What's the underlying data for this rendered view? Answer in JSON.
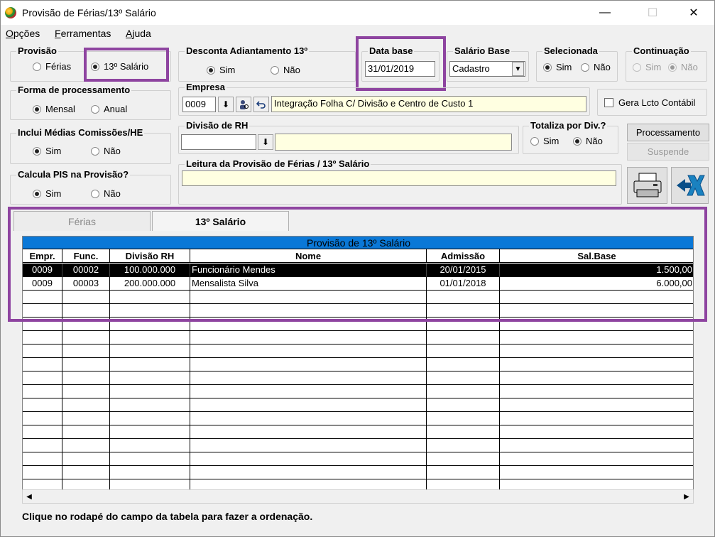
{
  "window": {
    "title": "Provisão de Férias/13º Salário",
    "minimize": "—",
    "maximize": "☐",
    "close": "✕"
  },
  "menu": [
    {
      "label": "Opções",
      "underline": "O"
    },
    {
      "label": "Ferramentas",
      "underline": "F"
    },
    {
      "label": "Ajuda",
      "underline": "A"
    }
  ],
  "provisao": {
    "legend": "Provisão",
    "ferias": "Férias",
    "decimo": "13º Salário",
    "selected": "decimo"
  },
  "desconta": {
    "legend": "Desconta Adiantamento 13º",
    "sim": "Sim",
    "nao": "Não",
    "selected": "sim"
  },
  "data_base": {
    "legend": "Data base",
    "value": "31/01/2019"
  },
  "salario_base": {
    "legend": "Salário Base",
    "value": "Cadastro"
  },
  "selecionada": {
    "legend": "Selecionada",
    "sim": "Sim",
    "nao": "Não",
    "selected": "sim"
  },
  "continuacao": {
    "legend": "Continuação",
    "sim": "Sim",
    "nao": "Não",
    "selected": "nao"
  },
  "forma_processamento": {
    "legend": "Forma de processamento",
    "mensal": "Mensal",
    "anual": "Anual",
    "selected": "mensal"
  },
  "empresa": {
    "legend": "Empresa",
    "code": "0009",
    "name": "Integração Folha C/ Divisão e Centro de Custo 1"
  },
  "gera_lcto": {
    "label": "Gera Lcto Contábil",
    "checked": false
  },
  "inclui_medias": {
    "legend": "Inclui Médias Comissões/HE",
    "sim": "Sim",
    "nao": "Não",
    "selected": "sim"
  },
  "divisao_rh": {
    "legend": "Divisão de RH",
    "code": "",
    "name": ""
  },
  "totaliza": {
    "legend": "Totaliza por Div.?",
    "sim": "Sim",
    "nao": "Não",
    "selected": "nao"
  },
  "buttons": {
    "processamento": "Processamento",
    "suspende": "Suspende"
  },
  "calcula_pis": {
    "legend": "Calcula PIS na Provisão?",
    "sim": "Sim",
    "nao": "Não",
    "selected": "sim"
  },
  "leitura": {
    "legend": "Leitura da Provisão de Férias / 13º Salário",
    "value": ""
  },
  "tabs": [
    {
      "label": "Férias",
      "active": false
    },
    {
      "label": "13º Salário",
      "active": true
    }
  ],
  "grid": {
    "caption": "Provisão de 13º Salário",
    "columns": [
      "Empr.",
      "Func.",
      "Divisão RH",
      "Nome",
      "Admissão",
      "Sal.Base"
    ],
    "rows": [
      [
        "0009",
        "00002",
        "100.000.000",
        "Funcionário Mendes",
        "20/01/2015",
        "1.500,00"
      ],
      [
        "0009",
        "00003",
        "200.000.000",
        "Mensalista Silva",
        "01/01/2018",
        "6.000,00"
      ]
    ],
    "selected_row": 0
  },
  "status": "Clique no rodapé do campo da tabela  para fazer a ordenação.",
  "colors": {
    "highlight": "#8e44a0",
    "grid_caption": "#0a78d7",
    "input_yellow": "#ffffe1"
  }
}
